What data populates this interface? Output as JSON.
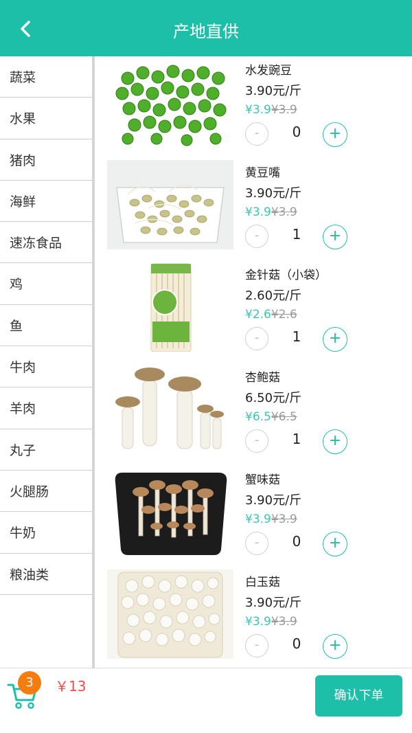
{
  "header": {
    "title": "产地直供"
  },
  "sidebar": {
    "items": [
      {
        "label": "蔬菜"
      },
      {
        "label": "水果"
      },
      {
        "label": "猪肉"
      },
      {
        "label": "海鲜"
      },
      {
        "label": "速冻食品"
      },
      {
        "label": "鸡"
      },
      {
        "label": "鱼"
      },
      {
        "label": "牛肉"
      },
      {
        "label": "羊肉"
      },
      {
        "label": "丸子"
      },
      {
        "label": "火腿肠"
      },
      {
        "label": "牛奶"
      },
      {
        "label": "粮油类"
      }
    ]
  },
  "products": [
    {
      "name": "水发豌豆",
      "price": "3.90元/斤",
      "sale": "¥3.9",
      "original": "¥3.9",
      "qty": "0"
    },
    {
      "name": "黄豆嘴",
      "price": "3.90元/斤",
      "sale": "¥3.9",
      "original": "¥3.9",
      "qty": "1"
    },
    {
      "name": "金针菇（小袋）",
      "price": "2.60元/斤",
      "sale": "¥2.6",
      "original": "¥2.6",
      "qty": "1"
    },
    {
      "name": "杏鲍菇",
      "price": "6.50元/斤",
      "sale": "¥6.5",
      "original": "¥6.5",
      "qty": "1"
    },
    {
      "name": "蟹味菇",
      "price": "3.90元/斤",
      "sale": "¥3.9",
      "original": "¥3.9",
      "qty": "0"
    },
    {
      "name": "白玉菇",
      "price": "3.90元/斤",
      "sale": "¥3.9",
      "original": "¥3.9",
      "qty": "0"
    }
  ],
  "controls": {
    "minus": "-",
    "plus": "+"
  },
  "footer": {
    "cart_count": "3",
    "total": "￥13",
    "confirm": "确认下单"
  },
  "colors": {
    "accent": "#1dbfa8",
    "badge": "#f57d10",
    "total": "#ef4b4b",
    "sale": "#3cc5b0"
  },
  "icons": {
    "back": "chevron-left-icon",
    "cart": "shopping-cart-icon"
  }
}
